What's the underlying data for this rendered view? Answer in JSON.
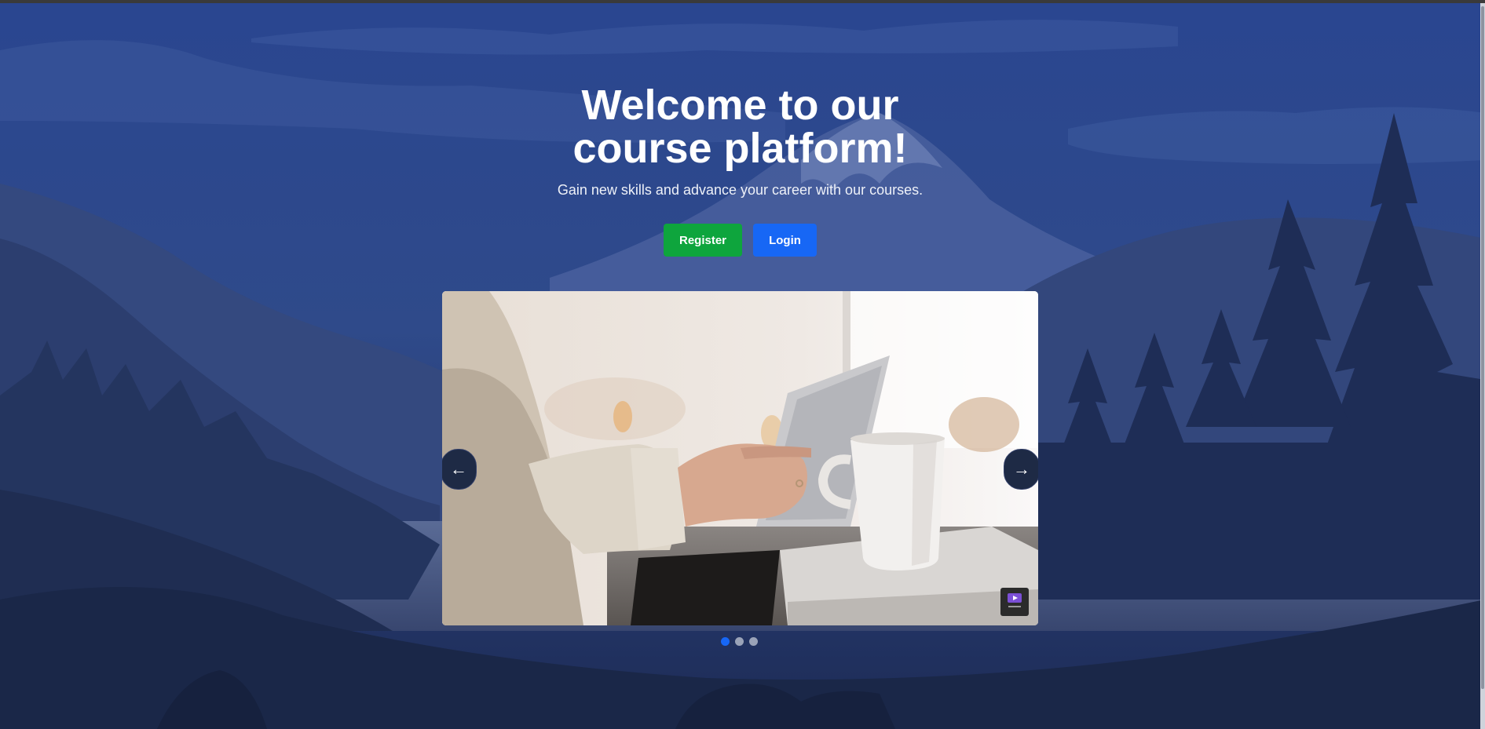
{
  "hero": {
    "title_line1": "Welcome to our",
    "title_line2": "course platform!",
    "subtitle": "Gain new skills and advance your career with our courses.",
    "register_label": "Register",
    "login_label": "Login"
  },
  "carousel": {
    "prev_label": "←",
    "next_label": "→",
    "image_icon": "pexels-logo-icon",
    "slide_count": 3,
    "active_slide": 1
  },
  "theme": {
    "register_color": "#0ea53d",
    "login_color": "#1767f5",
    "active_dot_color": "#1767f5"
  }
}
